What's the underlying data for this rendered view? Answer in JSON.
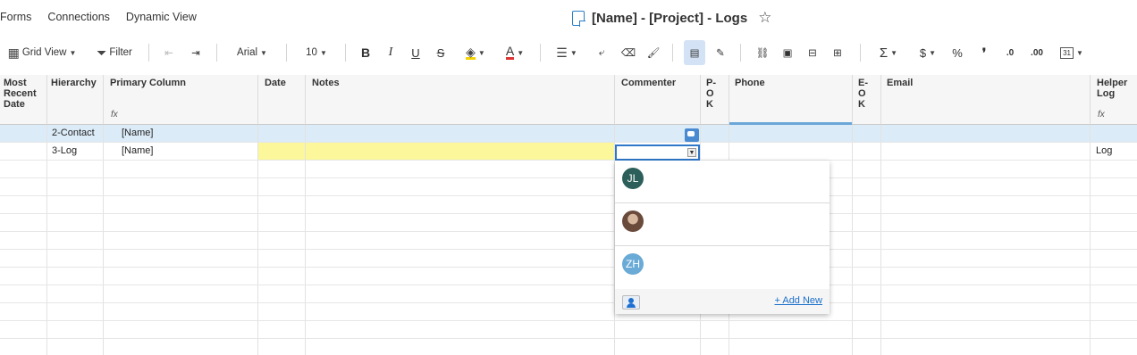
{
  "nav": {
    "forms": "Forms",
    "connections": "Connections",
    "dynamic_view": "Dynamic View"
  },
  "sheet": {
    "title": "[Name] - [Project] - Logs"
  },
  "toolbar": {
    "view": "Grid View",
    "filter": "Filter",
    "font": "Arial",
    "size": "10",
    "bold": "B",
    "italic": "I",
    "underline": "U",
    "strike": "S",
    "text_color_glyph": "A",
    "sum": "Σ",
    "currency": "$",
    "percent": "%",
    "comma": "❜",
    "dec_less": ".0",
    "dec_more": ".00",
    "calendar": "31"
  },
  "columns": {
    "most_recent_date": "Most Recent Date",
    "hierarchy": "Hierarchy",
    "primary": "Primary Column",
    "date": "Date",
    "notes": "Notes",
    "commenter": "Commenter",
    "p_ok": "P-OK",
    "phone": "Phone",
    "e_ok": "E-OK",
    "email": "Email",
    "helper_log": "Helper Log",
    "fx": "fx"
  },
  "rows": [
    {
      "hierarchy": "2-Contact",
      "primary": "[Name]",
      "helper": ""
    },
    {
      "hierarchy": "3-Log",
      "primary": "[Name]",
      "helper": "Log"
    }
  ],
  "dropdown": {
    "options": [
      {
        "initials": "JL",
        "color": "#2d5f5a"
      },
      {
        "initials": "",
        "color": "#8a6a5a"
      },
      {
        "initials": "ZH",
        "color": "#6aaad6"
      }
    ],
    "add_new": "+ Add New"
  }
}
